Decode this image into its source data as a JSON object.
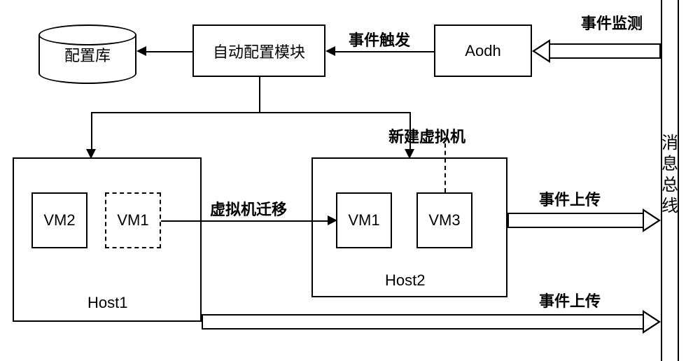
{
  "top": {
    "config_db": "配置库",
    "auto_config": "自动配置模块",
    "aodh": "Aodh",
    "edge_event_trigger": "事件触发",
    "edge_event_monitor": "事件监测"
  },
  "hosts": {
    "host1": {
      "label": "Host1",
      "vm2": "VM2",
      "vm1": "VM1"
    },
    "host2": {
      "label": "Host2",
      "vm1": "VM1",
      "vm3": "VM3",
      "new_vm_label": "新建虚拟机"
    },
    "migration": "虚拟机迁移"
  },
  "bus": {
    "label": "消息总线",
    "event_upload": "事件上传"
  },
  "chart_data": {
    "type": "diagram",
    "nodes": [
      {
        "id": "config_db",
        "label": "配置库",
        "kind": "datastore"
      },
      {
        "id": "auto_config",
        "label": "自动配置模块",
        "kind": "process"
      },
      {
        "id": "aodh",
        "label": "Aodh",
        "kind": "process"
      },
      {
        "id": "bus",
        "label": "消息总线",
        "kind": "bus"
      },
      {
        "id": "host1",
        "label": "Host1",
        "kind": "host",
        "contains": [
          "vm2",
          "vm1_src"
        ]
      },
      {
        "id": "host2",
        "label": "Host2",
        "kind": "host",
        "contains": [
          "vm1_dst",
          "vm3"
        ]
      },
      {
        "id": "vm2",
        "label": "VM2",
        "kind": "vm"
      },
      {
        "id": "vm1_src",
        "label": "VM1",
        "kind": "vm",
        "state": "migrated-out"
      },
      {
        "id": "vm1_dst",
        "label": "VM1",
        "kind": "vm"
      },
      {
        "id": "vm3",
        "label": "VM3",
        "kind": "vm",
        "state": "new",
        "note": "新建虚拟机"
      }
    ],
    "edges": [
      {
        "from": "auto_config",
        "to": "config_db"
      },
      {
        "from": "aodh",
        "to": "auto_config",
        "label": "事件触发"
      },
      {
        "from": "bus",
        "to": "aodh",
        "label": "事件监测"
      },
      {
        "from": "auto_config",
        "to": "host1"
      },
      {
        "from": "auto_config",
        "to": "host2"
      },
      {
        "from": "vm1_src",
        "to": "vm1_dst",
        "label": "虚拟机迁移"
      },
      {
        "from": "host2",
        "to": "bus",
        "label": "事件上传"
      },
      {
        "from": "host1",
        "to": "bus",
        "label": "事件上传"
      }
    ]
  }
}
